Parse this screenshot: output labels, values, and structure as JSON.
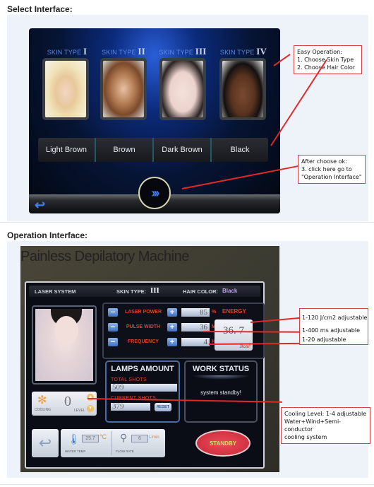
{
  "select_section": {
    "title": "Select Interface:",
    "skin_types": [
      {
        "label": "SKIN TYPE",
        "numeral": "I"
      },
      {
        "label": "SKIN TYPE",
        "numeral": "II"
      },
      {
        "label": "SKIN TYPE",
        "numeral": "III"
      },
      {
        "label": "SKIN TYPE",
        "numeral": "IV"
      }
    ],
    "hair_colors": [
      "Light Brown",
      "Brown",
      "Dark Brown",
      "Black"
    ],
    "next_icon": "triple-chevron-right-icon",
    "next_glyph": "›››",
    "back_icon": "return-arrow-icon",
    "back_glyph": "↩",
    "notes": {
      "easy_operation": [
        "Easy Operation:",
        "1. Choose Skin Type",
        "2. Choose Hair Color"
      ],
      "after_choose": [
        "After choose ok:",
        "3. click here go to",
        "\"Operation Interface\""
      ]
    }
  },
  "operation_section": {
    "title": "Operation Interface:",
    "machine_title": "Painless Depilatory Machine",
    "header": {
      "system": "LASER SYSTEM",
      "skin_type_label": "SKIN TYPE:",
      "skin_type_value": "III",
      "hair_color_label": "HAIR COLOR:",
      "hair_color_value": "Black"
    },
    "params": [
      {
        "label": "LASER POWER",
        "value": "85",
        "unit": "%"
      },
      {
        "label": "PULSE WIDTH",
        "value": "36",
        "unit": "MS"
      },
      {
        "label": "FREQUENCY",
        "value": "4",
        "unit": "HZ"
      }
    ],
    "minus": "−",
    "plus": "+",
    "energy": {
      "label": "ENERGY",
      "value": "36. 7",
      "unit": "J/cm²"
    },
    "lamps": {
      "title": "LAMPS AMOUNT",
      "total_label": "TOTAL SHOTS",
      "total_value": "509",
      "current_label": "CURRENT SHOTS",
      "current_value": "379",
      "reset": "RESET"
    },
    "work_status": {
      "title": "WORK STATUS",
      "message": "system standby!"
    },
    "cooling": {
      "label": "COOLING",
      "value": "0",
      "level_label": "LEVEL"
    },
    "water_temp": {
      "label": "WATER TEMP",
      "value": "25.7",
      "unit": "°C"
    },
    "flow_rate": {
      "label": "FLOW RATE",
      "value": "6",
      "unit": "L/min"
    },
    "standby": "STANDBY",
    "notes": {
      "energy": "1-120 J/cm2 adjustable",
      "pulse": "1-400 ms adjustable",
      "frequency": "1-20 adjustable",
      "cooling": [
        "Cooling Level: 1-4 adjustable",
        "Water+Wind+Semi-conductor",
        "cooling system"
      ]
    }
  }
}
